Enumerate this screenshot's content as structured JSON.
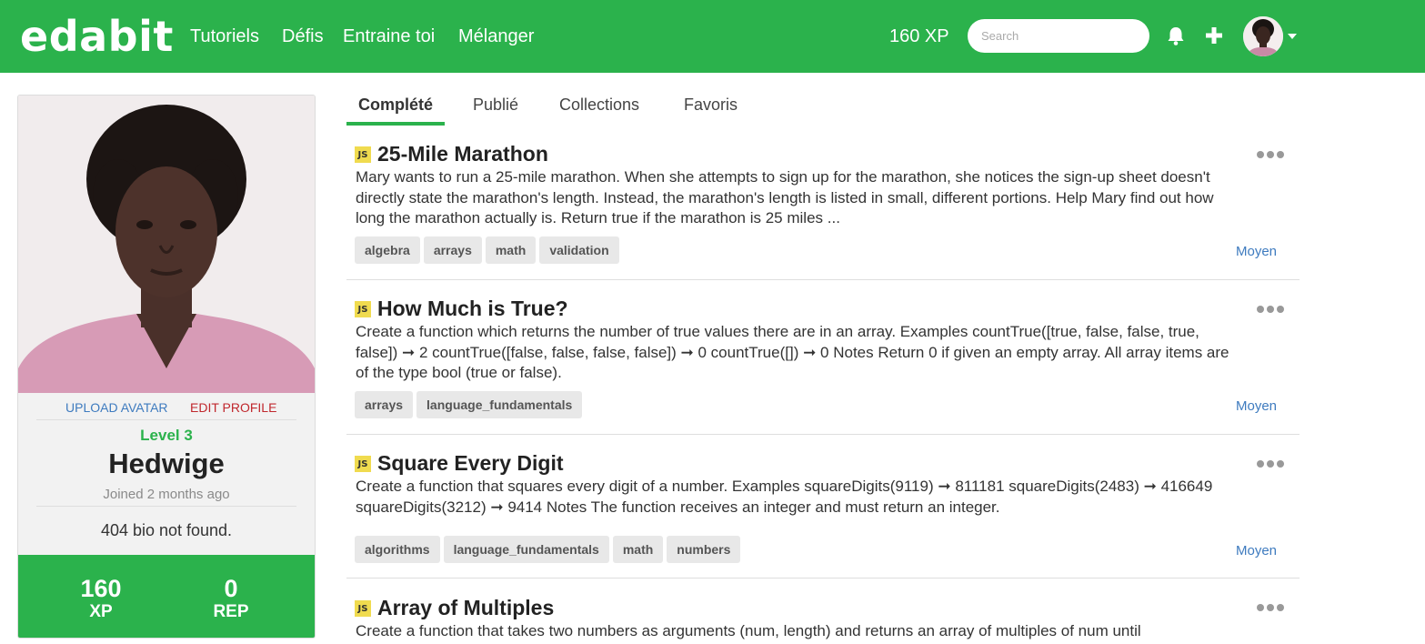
{
  "nav": {
    "logo": "edabit",
    "links": [
      "Tutoriels",
      "Défis",
      "Entraine toi",
      "Mélanger"
    ],
    "xp": "160 XP",
    "search_placeholder": "Search"
  },
  "profile": {
    "upload_avatar": "UPLOAD AVATAR",
    "edit_profile": "EDIT PROFILE",
    "level": "Level 3",
    "name": "Hedwige",
    "joined": "Joined 2 months ago",
    "bio": "404 bio not found.",
    "xp_value": "160",
    "xp_label": "XP",
    "rep_value": "0",
    "rep_label": "REP"
  },
  "tabs": [
    "Complété",
    "Publié",
    "Collections",
    "Favoris"
  ],
  "challenges": [
    {
      "language": "JS",
      "title": "25-Mile Marathon",
      "description": "Mary wants to run a 25-mile marathon. When she attempts to sign up for the marathon, she notices the sign-up sheet doesn't directly state the marathon's length. Instead, the marathon's length is listed in small, different portions. Help Mary find out how long the marathon actually is. Return true if the marathon is 25 miles ...",
      "tags": [
        "algebra",
        "arrays",
        "math",
        "validation"
      ],
      "difficulty": "Moyen"
    },
    {
      "language": "JS",
      "title": "How Much is True?",
      "description": "Create a function which returns the number of true values there are in an array. Examples countTrue([true, false, false, true, false]) ➞ 2 countTrue([false, false, false, false]) ➞ 0 countTrue([]) ➞ 0 Notes Return 0 if given an empty array. All array items are of the type bool (true or false).",
      "tags": [
        "arrays",
        "language_fundamentals"
      ],
      "difficulty": "Moyen"
    },
    {
      "language": "JS",
      "title": "Square Every Digit",
      "description": "Create a function that squares every digit of a number. Examples squareDigits(9119) ➞ 811181 squareDigits(2483) ➞ 416649 squareDigits(3212) ➞ 9414 Notes The function receives an integer and must return an integer.",
      "tags": [
        "algorithms",
        "language_fundamentals",
        "math",
        "numbers"
      ],
      "difficulty": "Moyen"
    },
    {
      "language": "JS",
      "title": "Array of Multiples",
      "description": "Create a function that takes two numbers as arguments (num, length) and returns an array of multiples of num until",
      "tags": [],
      "difficulty": ""
    }
  ],
  "colors": {
    "brand_green": "#2bb24c",
    "link_blue": "#3e7bbf",
    "edit_red": "#c0272d",
    "js_yellow": "#f0db4f"
  },
  "icons": [
    "bell-icon",
    "plus-icon",
    "chevron-down-icon",
    "more-dots-icon",
    "javascript-badge-icon"
  ]
}
